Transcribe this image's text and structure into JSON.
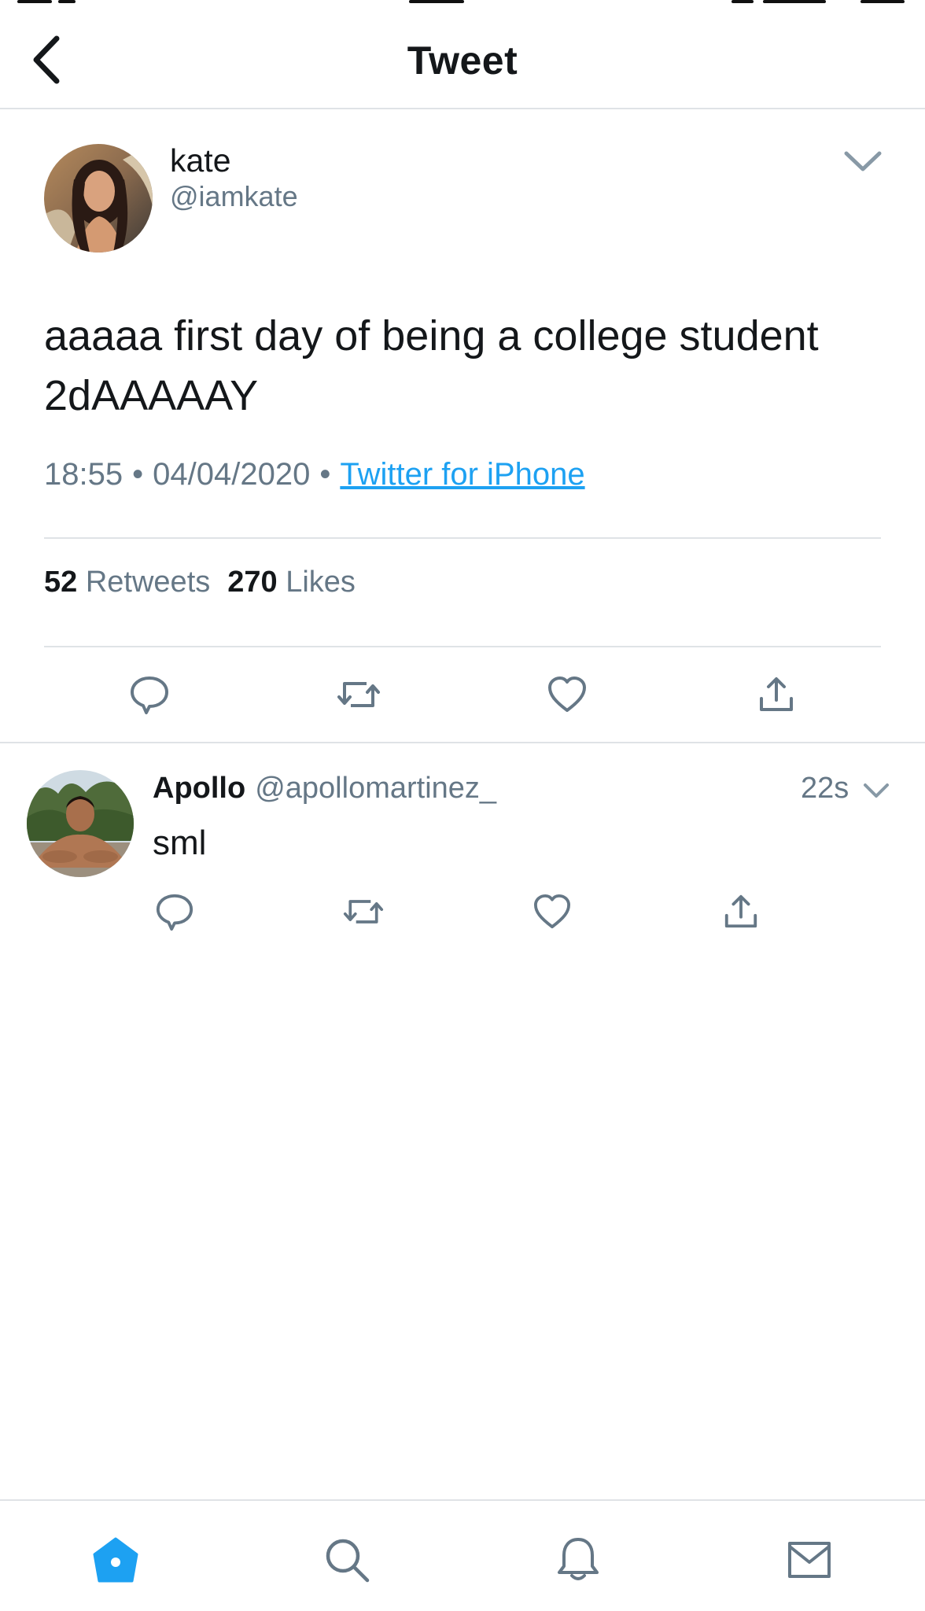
{
  "header": {
    "title": "Tweet"
  },
  "main_tweet": {
    "name": "kate",
    "handle": "@iamkate",
    "text": "aaaaa first day of being a college student 2dAAAAAY",
    "time": "18:55",
    "date": "04/04/2020",
    "source": "Twitter for iPhone",
    "retweets_count": "52",
    "retweets_label": "Retweets",
    "likes_count": "270",
    "likes_label": "Likes"
  },
  "reply": {
    "name": "Apollo",
    "handle": "@apollomartinez_",
    "time": "22s",
    "text": "sml"
  },
  "icons": {
    "back": "chevron-left-icon",
    "caret": "chevron-down-icon",
    "reply": "comment-bubble-icon",
    "retweet": "retweet-icon",
    "like": "heart-icon",
    "share": "share-upload-icon",
    "home": "home-icon",
    "search": "search-icon",
    "notifications": "bell-icon",
    "messages": "mail-icon"
  },
  "colors": {
    "accent": "#1da1f2",
    "secondary_text": "#657786",
    "primary_text": "#14171a",
    "divider": "#dfe3e6",
    "icon": "#657786"
  }
}
